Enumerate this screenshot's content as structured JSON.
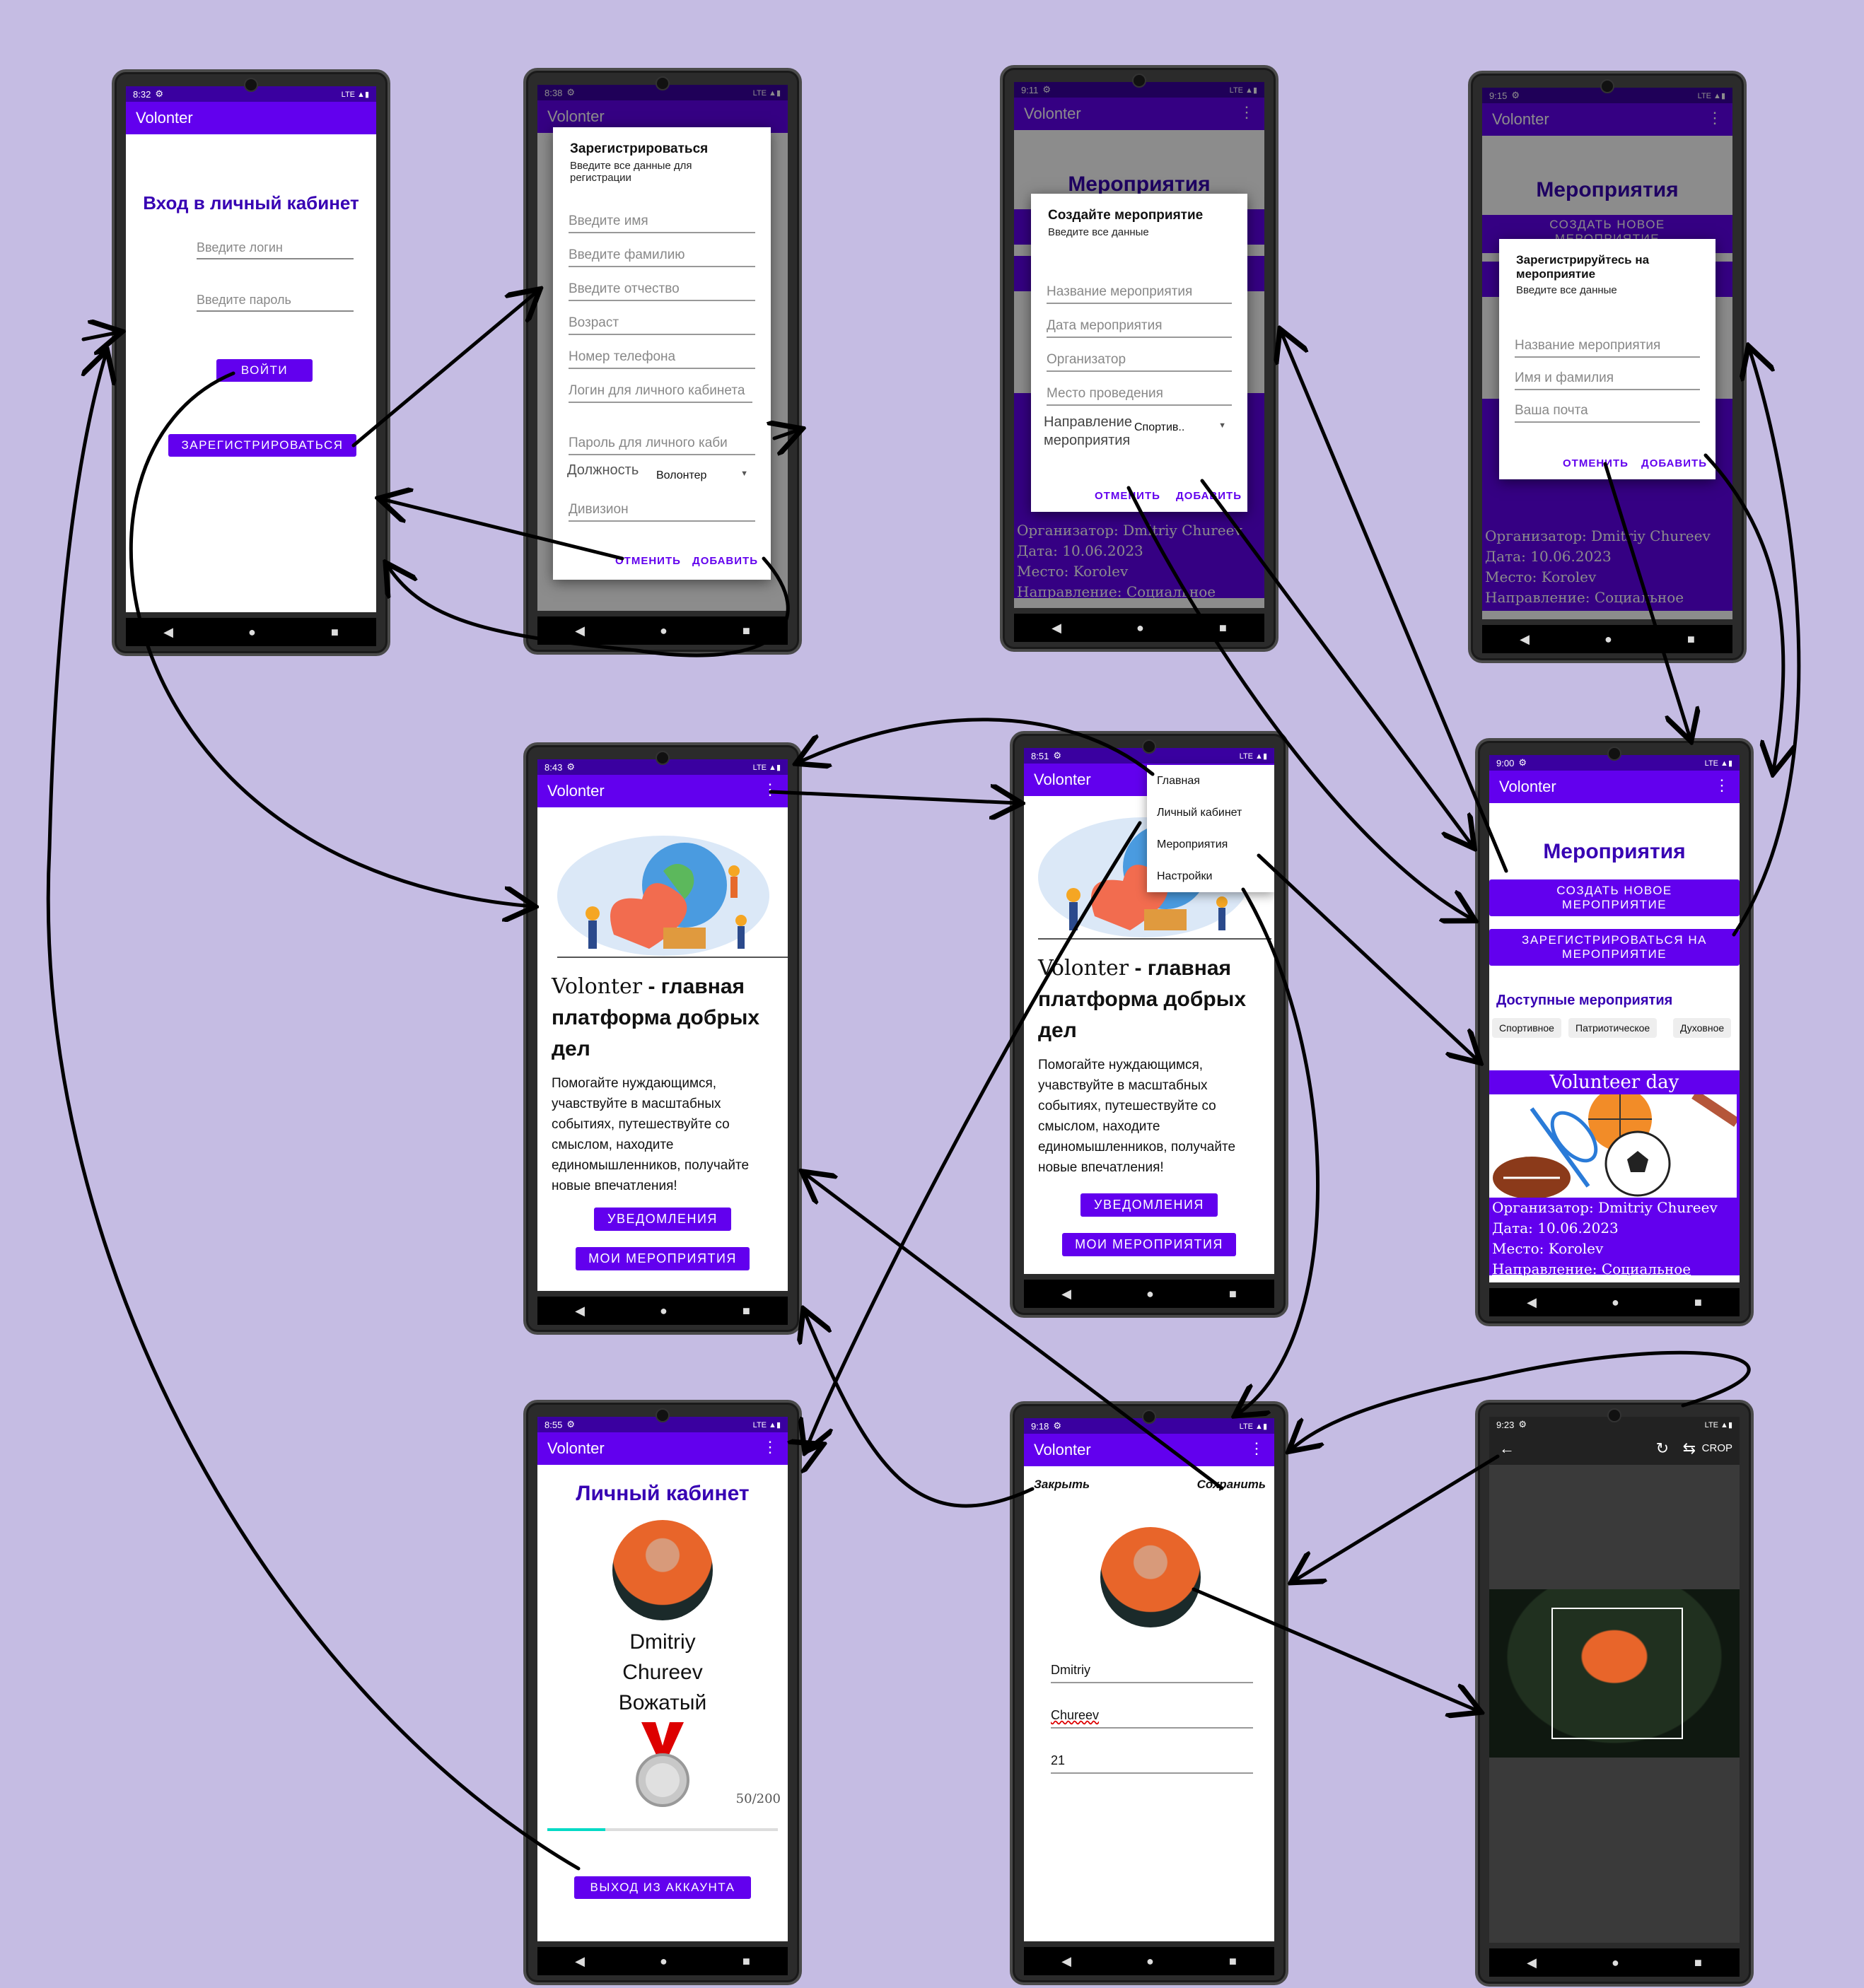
{
  "app_name": "Volonter",
  "colors": {
    "background": "#c5bce3",
    "primary": "#6200ee",
    "primary_dark": "#3700b3",
    "arrow": "#000000"
  },
  "login": {
    "time": "8:32",
    "title": "Вход в личный кабинет",
    "login_placeholder": "Введите логин",
    "password_placeholder": "Введите пароль",
    "login_button": "ВОЙТИ",
    "register_button": "ЗАРЕГИСТРИРОВАТЬСЯ"
  },
  "register": {
    "time": "8:38",
    "title": "Зарегистрироваться",
    "subtitle": "Введите все данные для регистрации",
    "fields": [
      "Введите имя",
      "Введите фамилию",
      "Введите отчество",
      "Возраст",
      "Номер телефона",
      "Логин для личного кабинета",
      "Пароль для личного каби"
    ],
    "role_label": "Должность",
    "role_value": "Волонтер",
    "division": "Дивизион",
    "cancel": "ОТМЕНИТЬ",
    "add": "ДОБАВИТЬ"
  },
  "create_event": {
    "time": "9:11",
    "bg_title": "Мероприятия",
    "title": "Создайте мероприятие",
    "subtitle": "Введите все данные",
    "fields": [
      "Название мероприятия",
      "Дата мероприятия",
      "Организатор",
      "Место проведения"
    ],
    "direction_label": "Направление мероприятия",
    "direction_value": "Спортив..",
    "cancel": "ОТМЕНИТЬ",
    "add": "ДОБАВИТЬ",
    "bg_lines": [
      "Организатор: Dmitriy Chureev",
      "Дата: 10.06.2023",
      "Место: Korolev",
      "Направление: Социальное"
    ]
  },
  "join_event": {
    "time": "9:15",
    "bg_title": "Мероприятия",
    "bg_button": "СОЗДАТЬ НОВОЕ МЕРОПРИЯТИЕ",
    "title": "Зарегистрируйтесь на мероприятие",
    "subtitle": "Введите все данные",
    "fields": [
      "Название мероприятия",
      "Имя и фамилия",
      "Ваша почта"
    ],
    "cancel": "ОТМЕНИТЬ",
    "add": "ДОБАВИТЬ",
    "bg_lines": [
      "Организатор: Dmitriy Chureev",
      "Дата: 10.06.2023",
      "Место: Korolev",
      "Направление: Социальное"
    ]
  },
  "home": {
    "time": "8:43",
    "heading_brand": "Volonter",
    "heading_rest": " - главная платформа добрых дел",
    "text": "Помогайте нуждающимся, учавствуйте в масштабных событиях, путешествуйте со смыслом, находите единомышленников, получайте новые впечатления!",
    "notifications": "УВЕДОМЛЕНИЯ",
    "my_events": "МОИ МЕРОПРИЯТИЯ"
  },
  "home_menu": {
    "time": "8:51",
    "items": [
      "Главная",
      "Личный кабинет",
      "Мероприятия",
      "Настройки"
    ]
  },
  "events": {
    "time": "9:00",
    "title": "Мероприятия",
    "create_button": "СОЗДАТЬ НОВОЕ МЕРОПРИЯТИЕ",
    "join_button": "ЗАРЕГИСТРИРОВАТЬСЯ НА МЕРОПРИЯТИЕ",
    "available": "Доступные мероприятия",
    "chips": [
      "Спортивное",
      "Патриотическое",
      "Духовное"
    ],
    "card_title": "Volunteer day",
    "card_lines": [
      "Организатор: Dmitriy Chureev",
      "Дата: 10.06.2023",
      "Место: Korolev",
      "Направление: Социальное"
    ]
  },
  "profile": {
    "time": "8:55",
    "title": "Личный кабинет",
    "first_name": "Dmitriy",
    "last_name": "Chureev",
    "role": "Вожатый",
    "progress_text": "50/200",
    "progress_value": 0.25,
    "logout": "ВЫХОД ИЗ АККАУНТА"
  },
  "edit_profile": {
    "time": "9:18",
    "close": "Закрыть",
    "save": "Сохранить",
    "first_name": "Dmitriy",
    "last_name": "Chureev",
    "age": "21"
  },
  "crop": {
    "time": "9:23",
    "crop_label": "CROP"
  }
}
